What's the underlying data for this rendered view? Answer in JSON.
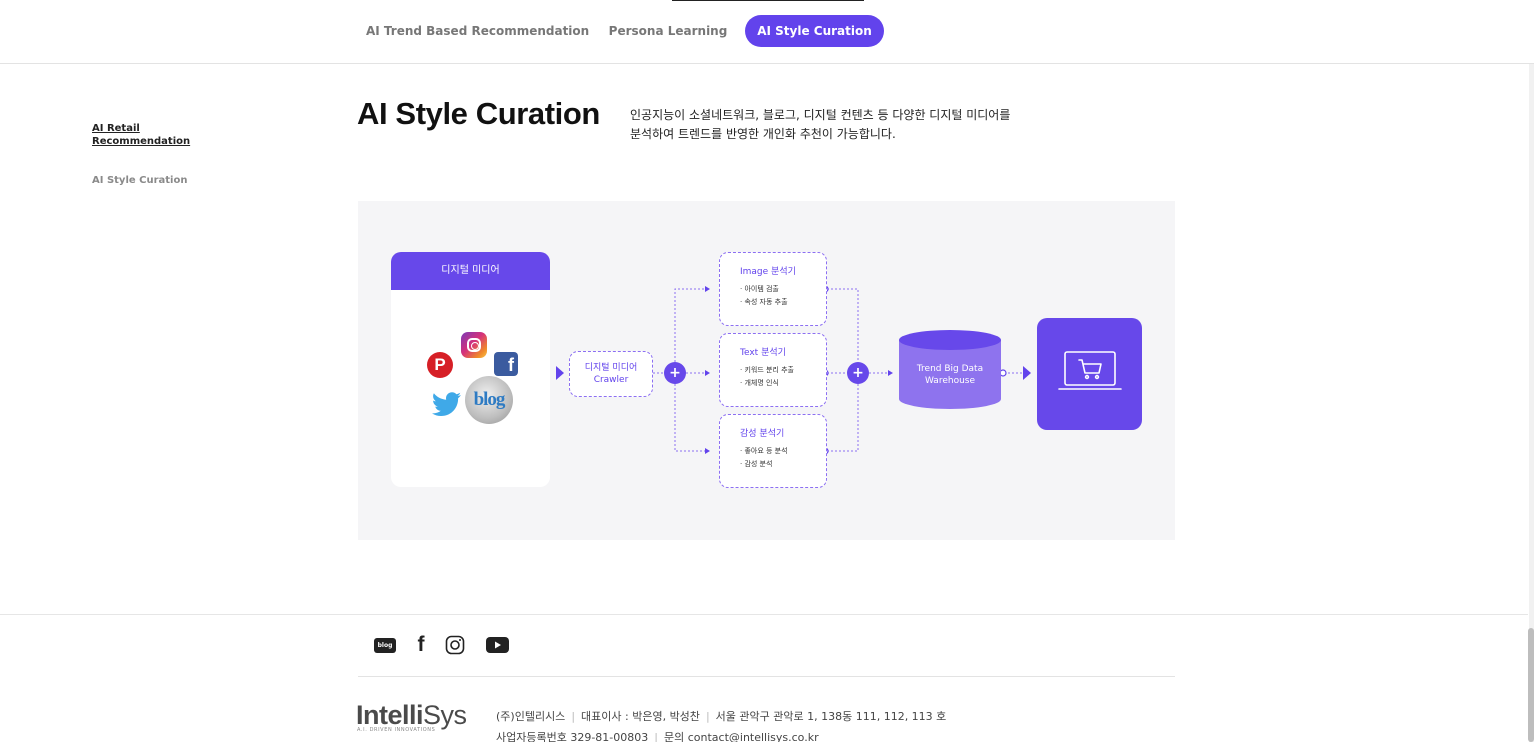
{
  "tabs": [
    {
      "label": "AI Trend Based Recommendation",
      "active": false
    },
    {
      "label": "Persona Learning",
      "active": false
    },
    {
      "label": "AI Style Curation",
      "active": true
    }
  ],
  "sidebar": {
    "active_line1": "AI Retail",
    "active_line2": "Recommendation",
    "item": "AI Style Curation"
  },
  "main": {
    "title": "AI Style Curation",
    "desc_line1": "인공지능이 소셜네트워크, 블로그, 디지털 컨텐츠 등 다양한 디지털 미디어를",
    "desc_line2": "분석하여 트렌드를 반영한 개인화 추천이 가능합니다."
  },
  "diagram": {
    "media_title": "디지털 미디어",
    "media_icons": [
      "pinterest-icon",
      "instagram-icon",
      "facebook-icon",
      "twitter-icon",
      "blog-icon"
    ],
    "blog_text": "blog",
    "crawler_line1": "디지털 미디어",
    "crawler_line2": "Crawler",
    "plus": "+",
    "analyzers": [
      {
        "title": "Image 분석기",
        "items": [
          "· 아이템 검출",
          "· 속성 자동 추출"
        ]
      },
      {
        "title": "Text 분석기",
        "items": [
          "· 키워드 분리 추출",
          "· 개체명 인식"
        ]
      },
      {
        "title": "감성 분석기",
        "items": [
          "· 좋아요 등 분석",
          "· 감성 분석"
        ]
      }
    ],
    "warehouse_line1": "Trend Big Data",
    "warehouse_line2": "Warehouse",
    "end_icon": "shopping-cart-monitor-icon"
  },
  "footer": {
    "social_icons": [
      "blog-icon",
      "facebook-icon",
      "instagram-icon",
      "youtube-icon"
    ],
    "blog_badge": "blog",
    "logo_bold": "Intelli",
    "logo_light": "Sys",
    "logo_tagline": "A.I. DRIVEN INNOVATIONS",
    "company": "(주)인텔리시스",
    "ceo": "대표이사 : 박은영, 박성찬",
    "address": "서울 관악구 관악로 1, 138동 111, 112, 113 호",
    "biz_no": "사업자등록번호 329-81-00803",
    "contact": "문의 contact@intellisys.co.kr"
  },
  "colors": {
    "accent": "#6243ec",
    "accent_light": "#8c6ff2",
    "diagram_bg": "#f5f5f7"
  }
}
